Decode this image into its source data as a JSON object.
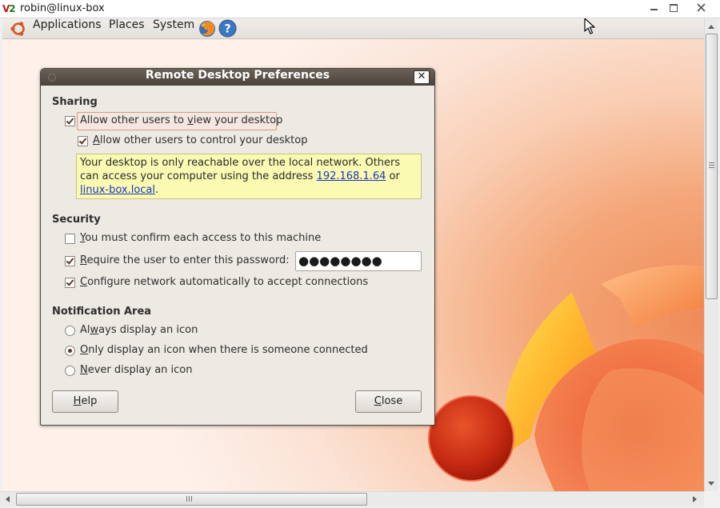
{
  "window": {
    "title": "robin@linux-box",
    "icon_text_1": "V",
    "icon_text_2": "2"
  },
  "panel": {
    "menus": [
      "Applications",
      "Places",
      "System"
    ]
  },
  "dialog": {
    "title": "Remote Desktop Preferences",
    "close_glyph": "✕",
    "sharing": {
      "heading": "Sharing",
      "allow_view": {
        "pre": "Allow other users to ",
        "mnemonic": "v",
        "post": "iew your desktop",
        "checked": true
      },
      "allow_control": {
        "pre": "",
        "mnemonic": "A",
        "post": "llow other users to control your desktop",
        "checked": true
      },
      "info": {
        "text_before": "Your desktop is only reachable over the local network. Others can access your computer using the address ",
        "address_ip": "192.168.1.64",
        "text_or": " or ",
        "address_host": "linux-box.local",
        "text_after": "."
      }
    },
    "security": {
      "heading": "Security",
      "confirm": {
        "pre": "",
        "mnemonic": "Y",
        "post": "ou must confirm each access to this machine",
        "checked": false
      },
      "require_password": {
        "pre": "",
        "mnemonic": "R",
        "post": "equire the user to enter this password:",
        "checked": true
      },
      "password_value": "●●●●●●●●",
      "configure_network": {
        "pre": "",
        "mnemonic": "C",
        "post": "onfigure network automatically to accept connections",
        "checked": true
      }
    },
    "notification": {
      "heading": "Notification Area",
      "always": {
        "pre": "Al",
        "mnemonic": "w",
        "post": "ays display an icon",
        "selected": false
      },
      "only": {
        "pre": "",
        "mnemonic": "O",
        "post": "nly display an icon when there is someone connected",
        "selected": true
      },
      "never": {
        "pre": "",
        "mnemonic": "N",
        "post": "ever display an icon",
        "selected": false
      }
    },
    "buttons": {
      "help": {
        "mnemonic": "H",
        "post": "elp"
      },
      "close": {
        "mnemonic": "C",
        "post": "lose"
      }
    }
  },
  "colors": {
    "accent_orange": "#f07746",
    "info_background": "#fafab2",
    "link": "#1c35b8"
  },
  "icons": [
    "ubuntu-logo-icon",
    "firefox-icon",
    "help-icon",
    "minimize-icon",
    "maximize-icon",
    "close-icon",
    "mouse-cursor-icon"
  ]
}
